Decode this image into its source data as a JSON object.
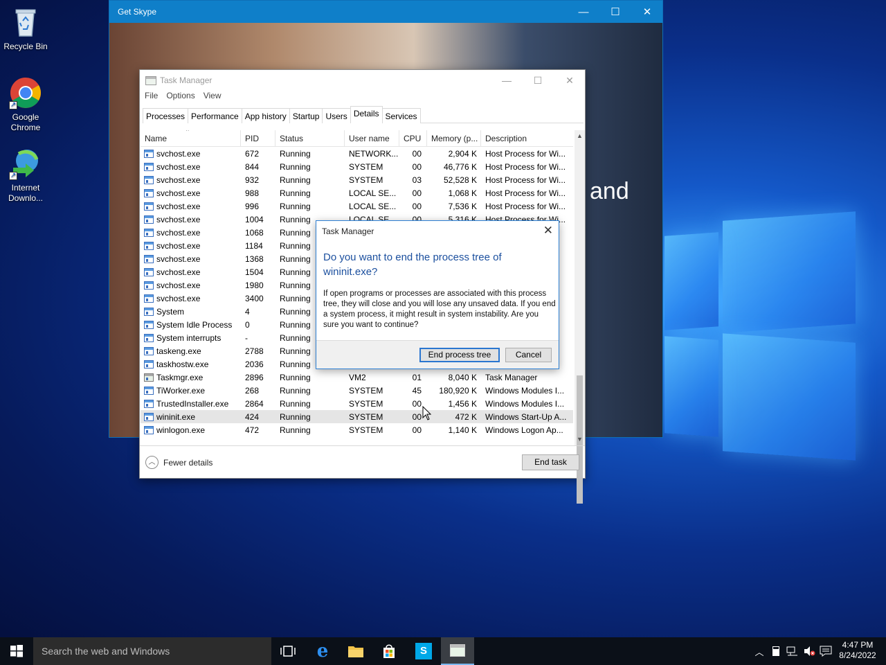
{
  "desktop": {
    "icons": [
      {
        "label_line1": "Recycle Bin",
        "label_line2": ""
      },
      {
        "label_line1": "Google",
        "label_line2": "Chrome"
      },
      {
        "label_line1": "Internet",
        "label_line2": "Downlo..."
      }
    ]
  },
  "skype": {
    "title": "Get Skype",
    "partial_text": "and"
  },
  "task_manager": {
    "title": "Task Manager",
    "menu": [
      "File",
      "Options",
      "View"
    ],
    "tabs": [
      "Processes",
      "Performance",
      "App history",
      "Startup",
      "Users",
      "Details",
      "Services"
    ],
    "active_tab": "Details",
    "columns": [
      "Name",
      "PID",
      "Status",
      "User name",
      "CPU",
      "Memory (p...",
      "Description"
    ],
    "rows": [
      {
        "name": "svchost.exe",
        "pid": "672",
        "status": "Running",
        "user": "NETWORK...",
        "cpu": "00",
        "mem": "2,904 K",
        "desc": "Host Process for Wi..."
      },
      {
        "name": "svchost.exe",
        "pid": "844",
        "status": "Running",
        "user": "SYSTEM",
        "cpu": "00",
        "mem": "46,776 K",
        "desc": "Host Process for Wi..."
      },
      {
        "name": "svchost.exe",
        "pid": "932",
        "status": "Running",
        "user": "SYSTEM",
        "cpu": "03",
        "mem": "52,528 K",
        "desc": "Host Process for Wi..."
      },
      {
        "name": "svchost.exe",
        "pid": "988",
        "status": "Running",
        "user": "LOCAL SE...",
        "cpu": "00",
        "mem": "1,068 K",
        "desc": "Host Process for Wi..."
      },
      {
        "name": "svchost.exe",
        "pid": "996",
        "status": "Running",
        "user": "LOCAL SE...",
        "cpu": "00",
        "mem": "7,536 K",
        "desc": "Host Process for Wi..."
      },
      {
        "name": "svchost.exe",
        "pid": "1004",
        "status": "Running",
        "user": "LOCAL SE...",
        "cpu": "00",
        "mem": "5,316 K",
        "desc": "Host Process for Wi..."
      },
      {
        "name": "svchost.exe",
        "pid": "1068",
        "status": "Running",
        "user": "",
        "cpu": "",
        "mem": "",
        "desc": ""
      },
      {
        "name": "svchost.exe",
        "pid": "1184",
        "status": "Running",
        "user": "",
        "cpu": "",
        "mem": "",
        "desc": ""
      },
      {
        "name": "svchost.exe",
        "pid": "1368",
        "status": "Running",
        "user": "",
        "cpu": "",
        "mem": "",
        "desc": ""
      },
      {
        "name": "svchost.exe",
        "pid": "1504",
        "status": "Running",
        "user": "",
        "cpu": "",
        "mem": "",
        "desc": ""
      },
      {
        "name": "svchost.exe",
        "pid": "1980",
        "status": "Running",
        "user": "",
        "cpu": "",
        "mem": "",
        "desc": ""
      },
      {
        "name": "svchost.exe",
        "pid": "3400",
        "status": "Running",
        "user": "",
        "cpu": "",
        "mem": "",
        "desc": ""
      },
      {
        "name": "System",
        "pid": "4",
        "status": "Running",
        "user": "",
        "cpu": "",
        "mem": "",
        "desc": ""
      },
      {
        "name": "System Idle Process",
        "pid": "0",
        "status": "Running",
        "user": "",
        "cpu": "",
        "mem": "",
        "desc": ""
      },
      {
        "name": "System interrupts",
        "pid": "-",
        "status": "Running",
        "user": "",
        "cpu": "",
        "mem": "",
        "desc": ""
      },
      {
        "name": "taskeng.exe",
        "pid": "2788",
        "status": "Running",
        "user": "",
        "cpu": "",
        "mem": "",
        "desc": ""
      },
      {
        "name": "taskhostw.exe",
        "pid": "2036",
        "status": "Running",
        "user": "",
        "cpu": "",
        "mem": "",
        "desc": ""
      },
      {
        "name": "Taskmgr.exe",
        "pid": "2896",
        "status": "Running",
        "user": "VM2",
        "cpu": "01",
        "mem": "8,040 K",
        "desc": "Task Manager"
      },
      {
        "name": "TiWorker.exe",
        "pid": "268",
        "status": "Running",
        "user": "SYSTEM",
        "cpu": "45",
        "mem": "180,920 K",
        "desc": "Windows Modules I..."
      },
      {
        "name": "TrustedInstaller.exe",
        "pid": "2864",
        "status": "Running",
        "user": "SYSTEM",
        "cpu": "00",
        "mem": "1,456 K",
        "desc": "Windows Modules I..."
      },
      {
        "name": "wininit.exe",
        "pid": "424",
        "status": "Running",
        "user": "SYSTEM",
        "cpu": "00",
        "mem": "472 K",
        "desc": "Windows Start-Up A..."
      },
      {
        "name": "winlogon.exe",
        "pid": "472",
        "status": "Running",
        "user": "SYSTEM",
        "cpu": "00",
        "mem": "1,140 K",
        "desc": "Windows Logon Ap..."
      }
    ],
    "selected_row": "wininit.exe",
    "fewer_details": "Fewer details",
    "end_task": "End task"
  },
  "dialog": {
    "title": "Task Manager",
    "question": "Do you want to end the process tree of wininit.exe?",
    "message": "If open programs or processes are associated with this process tree, they will close and you will lose any unsaved data. If you end a system process, it might result in system instability. Are you sure you want to continue?",
    "confirm_label": "End process tree",
    "cancel_label": "Cancel"
  },
  "taskbar": {
    "search_placeholder": "Search the web and Windows",
    "time": "4:47 PM",
    "date": "8/24/2022"
  },
  "colors": {
    "accent": "#0f7fc9",
    "dialog_heading": "#1b4f9e",
    "taskbar": "#0b1018"
  }
}
